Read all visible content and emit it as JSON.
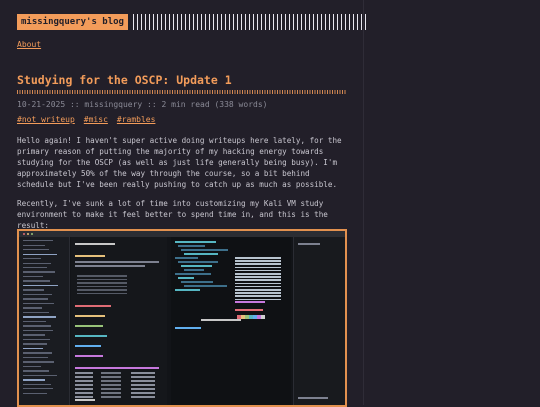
{
  "site": {
    "logo_text": "missingquery's blog"
  },
  "nav": {
    "about_label": "About"
  },
  "post": {
    "title": "Studying for the OSCP: Update 1",
    "meta": "10-21-2025 :: missingquery :: 2 min read (338 words)",
    "tags": [
      "#not writeup",
      "#misc",
      "#rambles"
    ],
    "paragraph_1": "Hello again! I haven't super active doing writeups here lately, for the primary reason of putting the majority of my hacking energy towards studying for the OSCP (as well as just life generally being busy). I'm approximately 50% of the way through the course, so a bit behind schedule but I've been really pushing to catch up as much as possible.",
    "paragraph_2": "Recently, I've sunk a lot of time into customizing my Kali VM study environment to make it feel better to spend time in, and this is the result:"
  },
  "colors": {
    "accent": "#f39c5a",
    "background": "#221f29",
    "text": "#c8c6cf",
    "muted": "#8a8a96"
  }
}
